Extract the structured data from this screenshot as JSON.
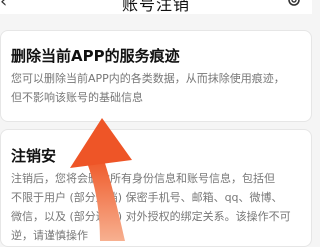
{
  "header": {
    "title": "账号注销",
    "icons": [
      "back-icon",
      "gear-icon"
    ]
  },
  "card_app_traces": {
    "title": "删除当前APP的服务痕迹",
    "description_line1": "您可以删除当前APP内的各类数据，从而抹除使用痕迹，",
    "description_line2": "但不影响该账号的基础信息"
  },
  "card_cancel_account": {
    "title": "注销安",
    "description_line1": "注销后，您将会删除所有身份信息和账号信息，包括但",
    "description_line2": "不限于用户 (部分遮挡) 保密手机号、邮箱、qq、微博、",
    "description_line3": "微信，以及 (部分遮挡) 对外授权的绑定关系。该操作不可",
    "description_line4": "逆，请谨慎操作"
  },
  "overlay": {
    "icon": "curved-arrow-icon",
    "color": "#f26a35"
  }
}
